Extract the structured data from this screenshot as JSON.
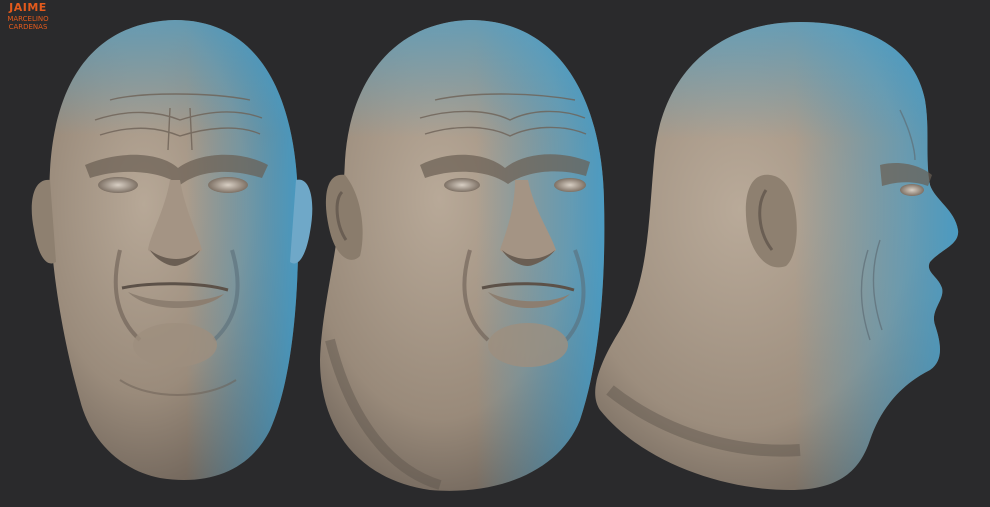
{
  "image": {
    "subject": "three clay-render sculpts of a bald male head: front view, three-quarter view and side profile",
    "background_color": "#2a2a2c",
    "clay_color": "#a89988",
    "rim_light_color": "#3aa8e0"
  },
  "watermark": {
    "line1": "JAIME",
    "line2": "MARCELINO",
    "line3": "CARDENAS",
    "color": "#e35a1c"
  }
}
